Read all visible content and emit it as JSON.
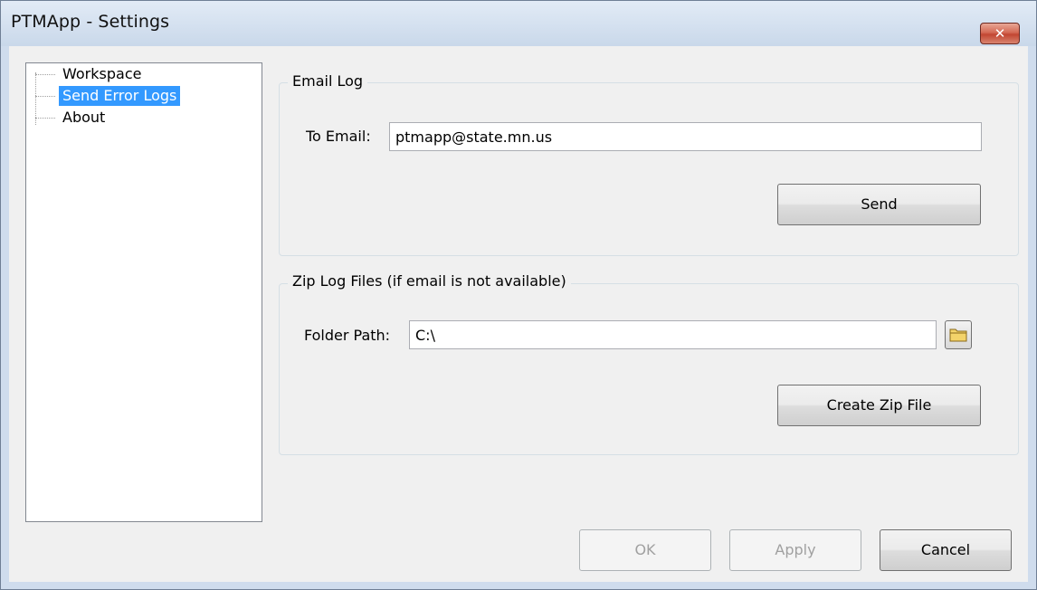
{
  "window": {
    "title": "PTMApp - Settings",
    "close_glyph": "✕"
  },
  "tree": {
    "items": [
      {
        "label": "Workspace",
        "selected": false
      },
      {
        "label": "Send Error Logs",
        "selected": true
      },
      {
        "label": "About",
        "selected": false
      }
    ]
  },
  "email_log": {
    "group_title": "Email Log",
    "to_email_label": "To Email:",
    "to_email_value": "ptmapp@state.mn.us",
    "send_label": "Send"
  },
  "zip_log": {
    "group_title": "Zip Log Files (if email is not available)",
    "folder_path_label": "Folder Path:",
    "folder_path_value": "C:\\",
    "browse_icon": "folder-icon",
    "create_zip_label": "Create Zip File"
  },
  "footer": {
    "ok_label": "OK",
    "apply_label": "Apply",
    "cancel_label": "Cancel"
  },
  "colors": {
    "selection": "#3399ff",
    "close_button": "#c24632",
    "titlebar": "#c9d8ea"
  }
}
